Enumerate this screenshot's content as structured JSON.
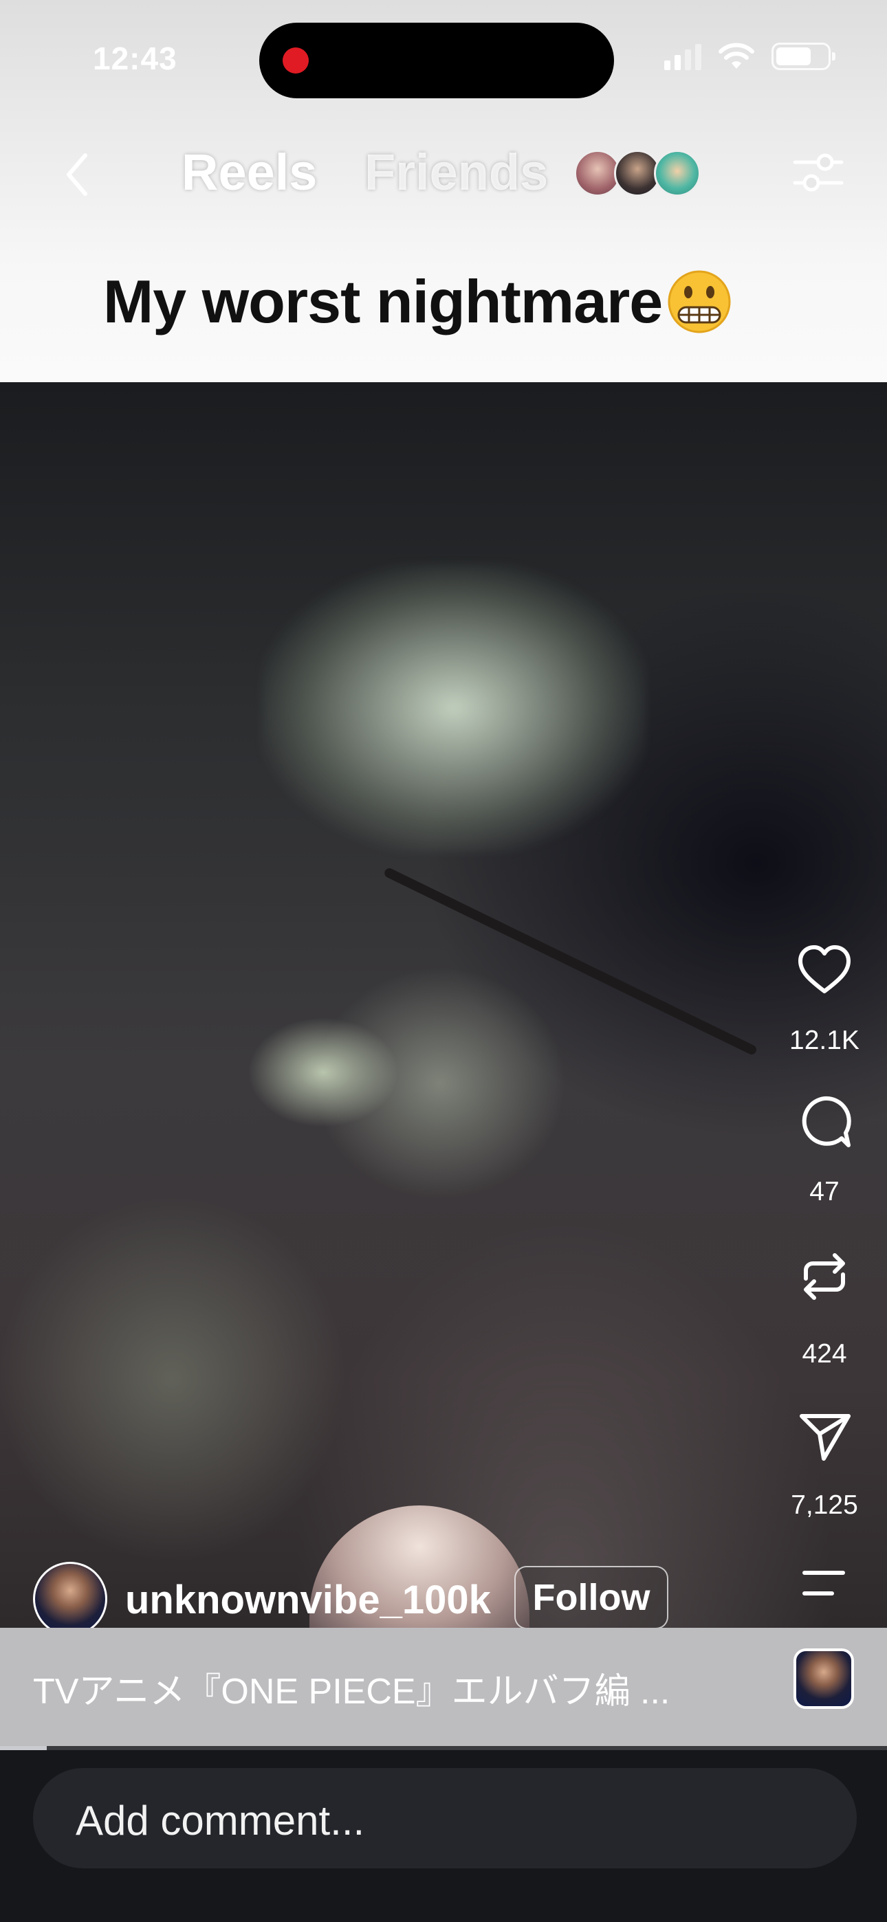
{
  "status_bar": {
    "time": "12:43"
  },
  "header": {
    "tabs": [
      {
        "label": "Reels",
        "active": true
      },
      {
        "label": "Friends",
        "active": false
      }
    ],
    "icons": {
      "back": "chevron-left-icon",
      "filter": "sliders-icon"
    }
  },
  "caption": {
    "text": "My worst nightmare",
    "emoji": "grimacing-face"
  },
  "actions": {
    "likes": "12.1K",
    "comments": "47",
    "reposts": "424",
    "shares": "7,125"
  },
  "author": {
    "username": "unknownvibe_100k",
    "follow_label": "Follow"
  },
  "audio": {
    "title": "TVアニメ『ONE PIECE』エルバフ編 ..."
  },
  "progress": {
    "fraction": 0.053
  },
  "comment": {
    "placeholder": "Add comment..."
  },
  "colors": {
    "accent_red": "#e01b24",
    "bottom_bg": "#16171b",
    "audio_bar": "#bdbdc0"
  }
}
